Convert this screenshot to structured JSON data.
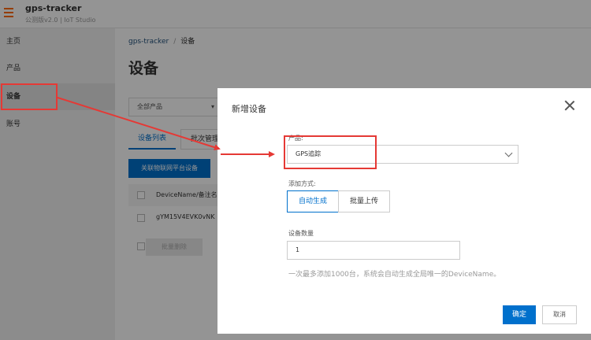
{
  "app": {
    "name": "gps-tracker",
    "caret": "▾",
    "subtitle": "公测版v2.0 | IoT Studio"
  },
  "sidebar": {
    "items": [
      {
        "label": "主页"
      },
      {
        "label": "产品"
      },
      {
        "label": "设备",
        "active": true
      },
      {
        "label": "账号"
      }
    ]
  },
  "main": {
    "breadcrumb": {
      "root": "gps-tracker",
      "separator": "/",
      "current": "设备"
    },
    "title": "设备",
    "filter": {
      "value": "全部产品"
    },
    "tabs": [
      {
        "label": "设备列表",
        "active": true
      },
      {
        "label": "批次管理"
      }
    ],
    "link_button": "关联物联网平台设备",
    "table": {
      "header": "DeviceName/备注名",
      "rows": [
        {
          "name": "gYM15V4EVK0vNK"
        }
      ]
    },
    "batch_delete": "批量删除"
  },
  "modal": {
    "title": "新增设备",
    "product": {
      "label": "产品:",
      "value": "GPS追踪"
    },
    "mode": {
      "label": "添加方式:",
      "options": [
        "自动生成",
        "批量上传"
      ],
      "selected": "自动生成"
    },
    "quantity": {
      "label": "设备数量",
      "value": "1"
    },
    "help_text": "一次最多添加1000台，系统会自动生成全局唯一的DeviceName。",
    "confirm": "确定",
    "cancel": "取消"
  },
  "colors": {
    "accent": "#0070cc",
    "brand": "#ff6a00",
    "annotation": "#e53935"
  }
}
